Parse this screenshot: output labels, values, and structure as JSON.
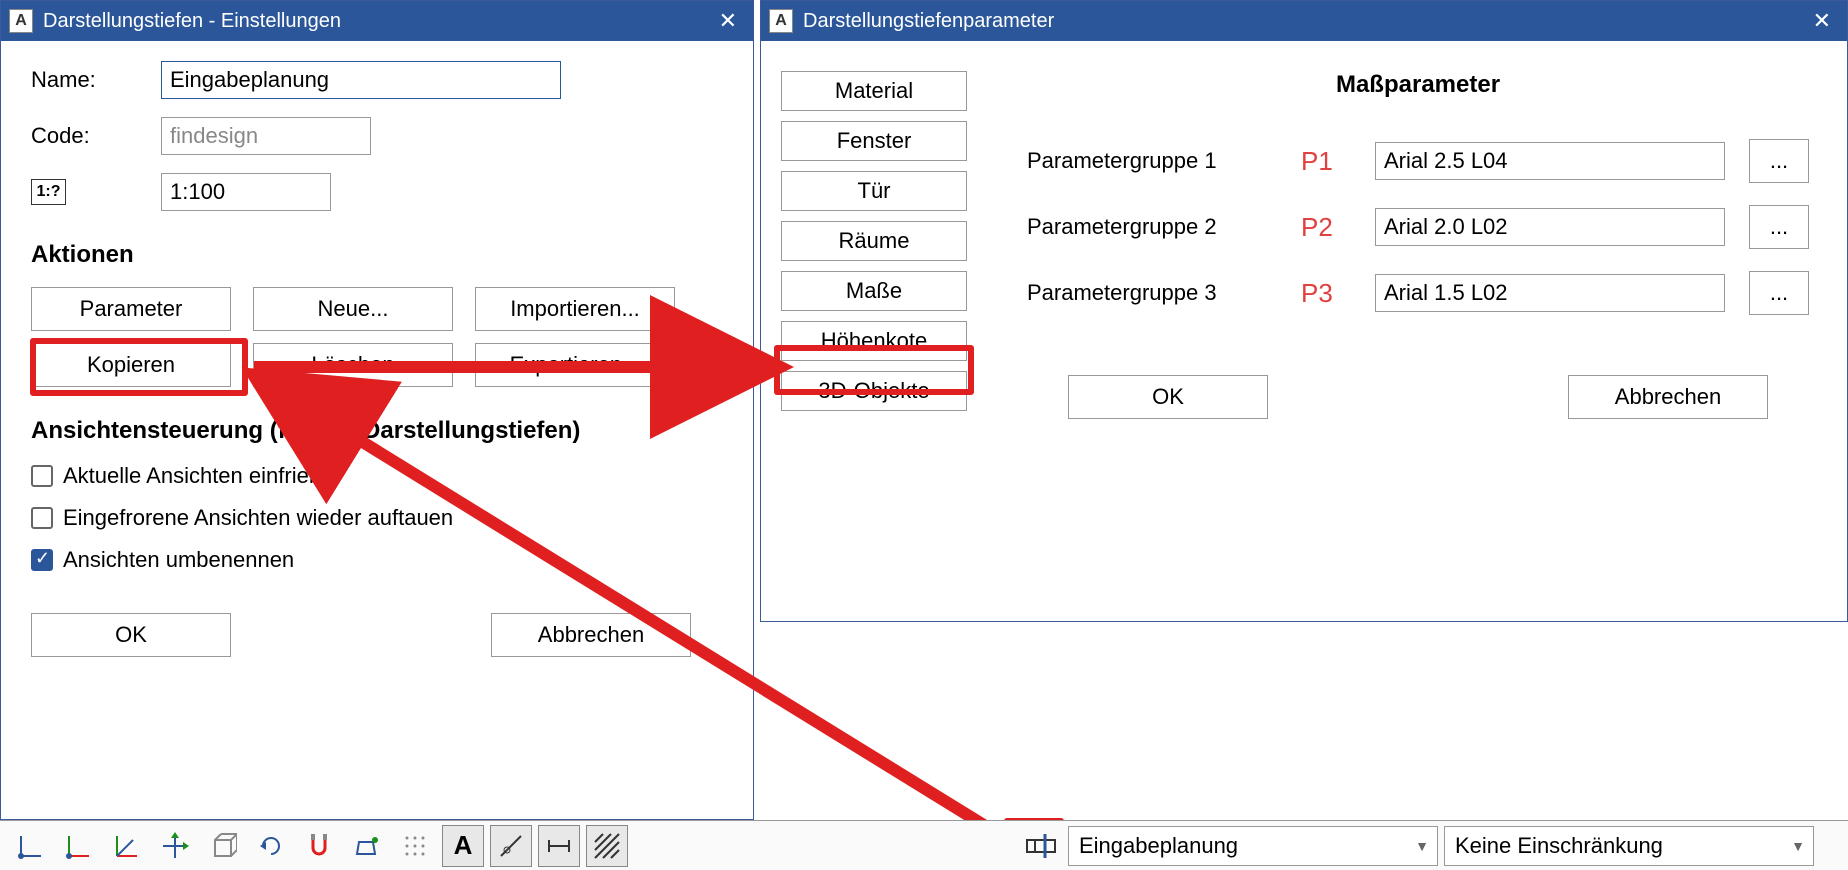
{
  "dialog_left": {
    "title": "Darstellungstiefen - Einstellungen",
    "fields": {
      "name_label": "Name:",
      "name_value": "Eingabeplanung",
      "code_label": "Code:",
      "code_value": "findesign",
      "scale_icon": "1:?",
      "scale_value": "1:100"
    },
    "actions_label": "Aktionen",
    "buttons": {
      "parameter": "Parameter",
      "neue": "Neue...",
      "importieren": "Importieren...",
      "kopieren": "Kopieren",
      "loeschen": "Löschen",
      "exportieren": "Exportieren..."
    },
    "view_section": "Ansichtensteuerung (für alle Darstellungstiefen)",
    "checks": {
      "freeze": "Aktuelle Ansichten einfrieren",
      "thaw": "Eingefrorene Ansichten wieder auftauen",
      "rename": "Ansichten umbenennen"
    },
    "ok": "OK",
    "cancel": "Abbrechen"
  },
  "dialog_right": {
    "title": "Darstellungstiefenparameter",
    "panel_title": "Maßparameter",
    "sidebtns": {
      "material": "Material",
      "fenster": "Fenster",
      "tuer": "Tür",
      "raeume": "Räume",
      "masse": "Maße",
      "hoehenkote": "Höhenkote",
      "obj3d": "3D-Objekte"
    },
    "params": [
      {
        "label": "Parametergruppe 1",
        "id": "P1",
        "value": "Arial 2.5 L04",
        "dots": "..."
      },
      {
        "label": "Parametergruppe 2",
        "id": "P2",
        "value": "Arial 2.0 L02",
        "dots": "..."
      },
      {
        "label": "Parametergruppe 3",
        "id": "P3",
        "value": "Arial 1.5 L02",
        "dots": "..."
      }
    ],
    "ok": "OK",
    "cancel": "Abbrechen"
  },
  "toolbar": {
    "dd1": "Eingabeplanung",
    "dd2": "Keine Einschränkung"
  }
}
